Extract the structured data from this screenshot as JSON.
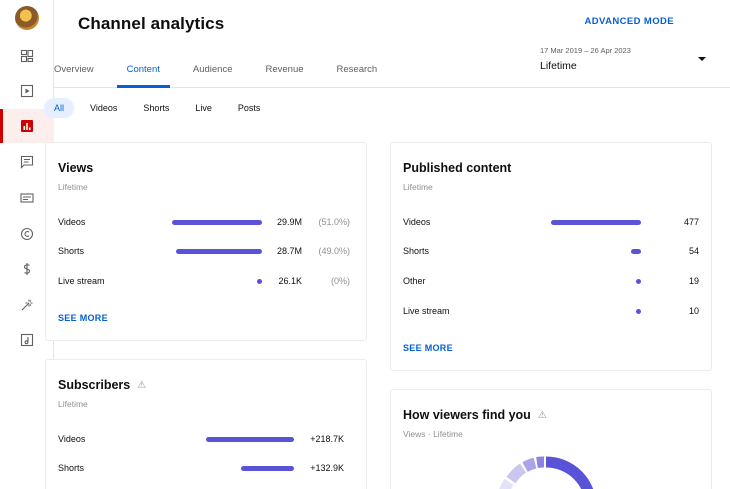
{
  "header": {
    "title": "Channel analytics",
    "advanced_mode": "ADVANCED MODE",
    "date_range": "17 Mar 2019 – 26 Apr 2023",
    "date_value": "Lifetime"
  },
  "tabs": [
    {
      "label": "Overview"
    },
    {
      "label": "Content"
    },
    {
      "label": "Audience"
    },
    {
      "label": "Revenue"
    },
    {
      "label": "Research"
    }
  ],
  "active_tab": "Content",
  "chips": [
    {
      "label": "All"
    },
    {
      "label": "Videos"
    },
    {
      "label": "Shorts"
    },
    {
      "label": "Live"
    },
    {
      "label": "Posts"
    }
  ],
  "active_chip": "All",
  "sidebar": {
    "items": [
      "dashboard-icon",
      "content-icon",
      "analytics-icon",
      "comments-icon",
      "subtitles-icon",
      "copyright-icon",
      "earn-icon",
      "customisation-icon",
      "audio-library-icon"
    ],
    "active": "analytics-icon"
  },
  "colors": {
    "accent": "#065fd4",
    "bar": "#5a53d8",
    "active_indicator": "#cc0000"
  },
  "views_card": {
    "title": "Views",
    "subtitle": "Lifetime",
    "rows": [
      {
        "label": "Videos",
        "value": "29.9M",
        "pct": "(51.0%)",
        "share": 0.51
      },
      {
        "label": "Shorts",
        "value": "28.7M",
        "pct": "(49.0%)",
        "share": 0.49
      },
      {
        "label": "Live stream",
        "value": "26.1K",
        "pct": "(0%)",
        "share": 0
      }
    ],
    "see_more": "SEE MORE"
  },
  "published_card": {
    "title": "Published content",
    "subtitle": "Lifetime",
    "rows": [
      {
        "label": "Videos",
        "value": "477",
        "count": 477
      },
      {
        "label": "Shorts",
        "value": "54",
        "count": 54
      },
      {
        "label": "Other",
        "value": "19",
        "count": 19
      },
      {
        "label": "Live stream",
        "value": "10",
        "count": 10
      }
    ],
    "see_more": "SEE MORE"
  },
  "subscribers_card": {
    "title": "Subscribers",
    "subtitle": "Lifetime",
    "rows": [
      {
        "label": "Videos",
        "value": "+218.7K",
        "count": 218.7
      },
      {
        "label": "Shorts",
        "value": "+132.9K",
        "count": 132.9
      }
    ]
  },
  "viewers_card": {
    "title": "How viewers find you",
    "subtitle": "Views · Lifetime"
  }
}
